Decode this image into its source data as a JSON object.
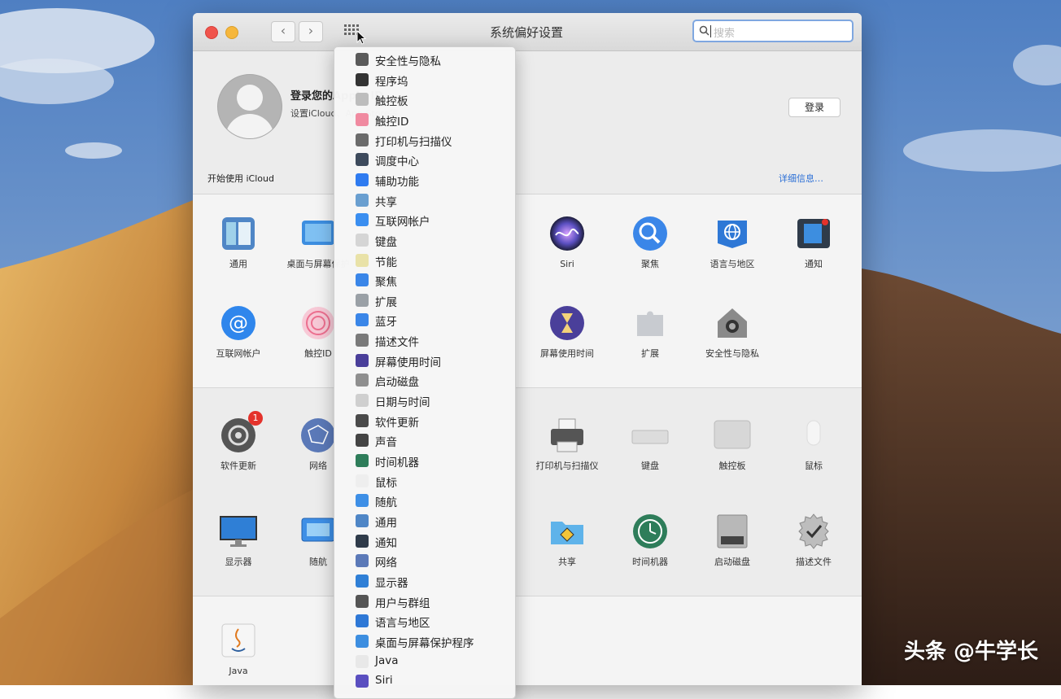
{
  "window": {
    "title": "系统偏好设置",
    "search_placeholder": "搜索"
  },
  "account": {
    "title": "登录您的Apple ID",
    "subtitle": "设置iCloud、App Store等",
    "login_button": "登录",
    "icloud_start": "开始使用 iCloud",
    "more_link": "详细信息…"
  },
  "grid": {
    "row1": [
      {
        "label": "通用",
        "icon": "general-icon"
      },
      {
        "label": "桌面与屏幕保护",
        "icon": "desktop-icon"
      },
      {
        "label": "Siri",
        "icon": "siri-icon"
      },
      {
        "label": "聚焦",
        "icon": "spotlight-icon"
      },
      {
        "label": "语言与地区",
        "icon": "language-icon"
      },
      {
        "label": "通知",
        "icon": "notifications-icon"
      }
    ],
    "row2": [
      {
        "label": "互联网帐户",
        "icon": "internet-accounts-icon"
      },
      {
        "label": "触控ID",
        "icon": "touchid-icon"
      },
      {
        "label": "屏幕使用时间",
        "icon": "screentime-icon"
      },
      {
        "label": "扩展",
        "icon": "extensions-icon"
      },
      {
        "label": "安全性与隐私",
        "icon": "security-icon"
      }
    ],
    "row3": [
      {
        "label": "软件更新",
        "icon": "software-update-icon",
        "badge": "1"
      },
      {
        "label": "网络",
        "icon": "network-icon"
      },
      {
        "label": "打印机与扫描仪",
        "icon": "printer-icon"
      },
      {
        "label": "键盘",
        "icon": "keyboard-icon"
      },
      {
        "label": "触控板",
        "icon": "trackpad-icon"
      },
      {
        "label": "鼠标",
        "icon": "mouse-icon"
      }
    ],
    "row4": [
      {
        "label": "显示器",
        "icon": "display-icon"
      },
      {
        "label": "随航",
        "icon": "sidecar-icon"
      },
      {
        "label": "共享",
        "icon": "sharing-icon"
      },
      {
        "label": "时间机器",
        "icon": "timemachine-icon"
      },
      {
        "label": "启动磁盘",
        "icon": "startup-disk-icon"
      },
      {
        "label": "描述文件",
        "icon": "profiles-icon"
      }
    ],
    "row5": [
      {
        "label": "Java",
        "icon": "java-icon"
      }
    ]
  },
  "menu": {
    "items": [
      {
        "label": "安全性与隐私",
        "color": "#5a5a5a"
      },
      {
        "label": "程序坞",
        "color": "#333333"
      },
      {
        "label": "触控板",
        "color": "#bdbdbd"
      },
      {
        "label": "触控ID",
        "color": "#f08aa0"
      },
      {
        "label": "打印机与扫描仪",
        "color": "#6b6b6b"
      },
      {
        "label": "调度中心",
        "color": "#3d4a5c"
      },
      {
        "label": "辅助功能",
        "color": "#2f7bf0"
      },
      {
        "label": "共享",
        "color": "#6a9fd0"
      },
      {
        "label": "互联网帐户",
        "color": "#3a8ef0"
      },
      {
        "label": "键盘",
        "color": "#d5d5d5"
      },
      {
        "label": "节能",
        "color": "#e9e2a8"
      },
      {
        "label": "聚焦",
        "color": "#3a86e8"
      },
      {
        "label": "扩展",
        "color": "#9aa0a6"
      },
      {
        "label": "蓝牙",
        "color": "#3a86e8"
      },
      {
        "label": "描述文件",
        "color": "#7a7a7a"
      },
      {
        "label": "屏幕使用时间",
        "color": "#4a3f9a"
      },
      {
        "label": "启动磁盘",
        "color": "#8f8f8f"
      },
      {
        "label": "日期与时间",
        "color": "#cfcfcf"
      },
      {
        "label": "软件更新",
        "color": "#4a4a4a"
      },
      {
        "label": "声音",
        "color": "#444444"
      },
      {
        "label": "时间机器",
        "color": "#2e7d5a"
      },
      {
        "label": "鼠标",
        "color": "#eeeeee"
      },
      {
        "label": "随航",
        "color": "#3e8fe6"
      },
      {
        "label": "通用",
        "color": "#4f86c6"
      },
      {
        "label": "通知",
        "color": "#2f3b4a"
      },
      {
        "label": "网络",
        "color": "#5b79b8"
      },
      {
        "label": "显示器",
        "color": "#2f7fd6"
      },
      {
        "label": "用户与群组",
        "color": "#555555"
      },
      {
        "label": "语言与地区",
        "color": "#2e78d6"
      },
      {
        "label": "桌面与屏幕保护程序",
        "color": "#3d8ee0"
      },
      {
        "label": "Java",
        "color": "#e8e8e8"
      },
      {
        "label": "Siri",
        "color": "#5a4fc0"
      }
    ]
  },
  "watermark": "头条 @牛学长",
  "colors": {
    "sky": "#5b86c4",
    "dune_light": "#d7a257",
    "dune_dark": "#4a3326",
    "accent": "#2b6fd6"
  }
}
